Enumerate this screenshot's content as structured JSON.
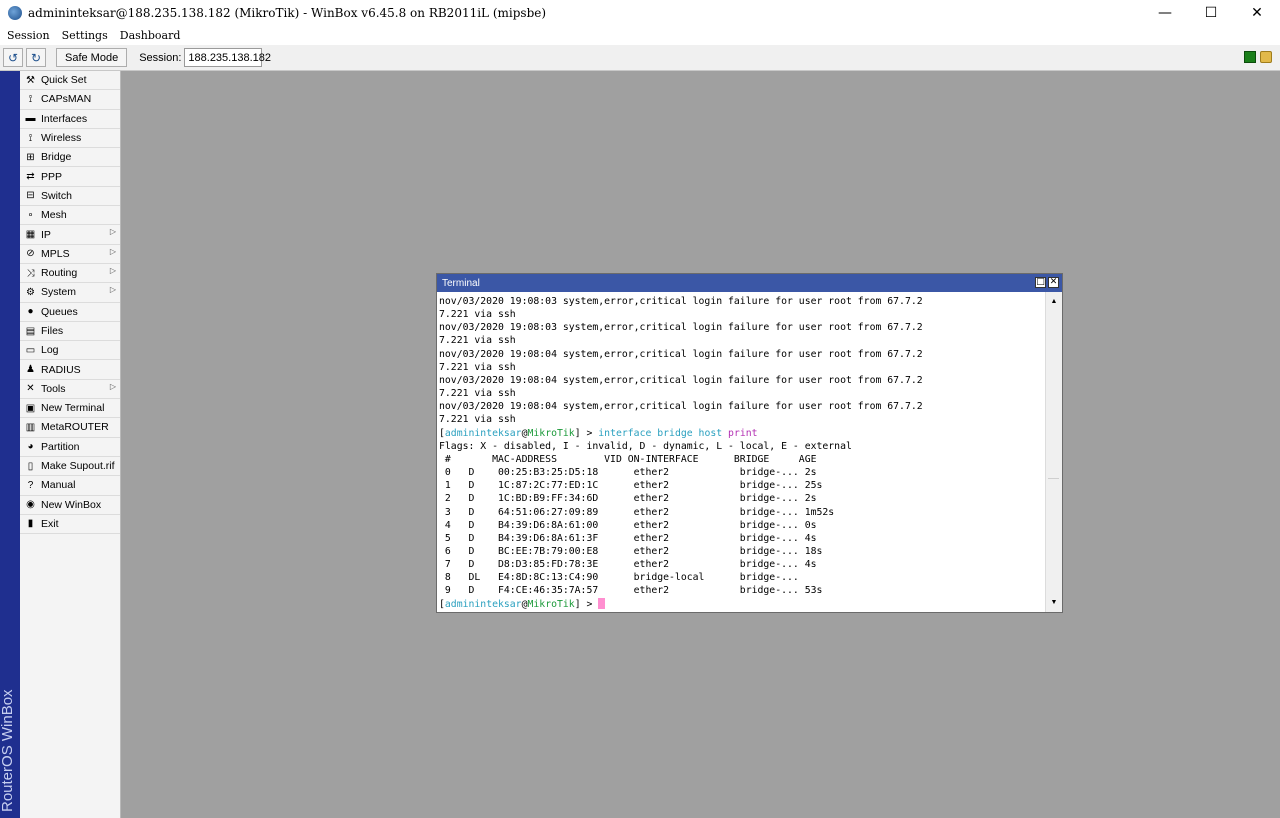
{
  "window": {
    "title": "admininteksar@188.235.138.182 (MikroTik) - WinBox v6.45.8 on RB2011iL (mipsbe)",
    "controls": {
      "minimize": "—",
      "maximize": "☐",
      "close": "✕"
    }
  },
  "menubar": {
    "items": [
      "Session",
      "Settings",
      "Dashboard"
    ]
  },
  "toolbar": {
    "undo_icon": "↺",
    "redo_icon": "↻",
    "safe_mode_label": "Safe Mode",
    "session_label": "Session:",
    "session_value": "188.235.138.182"
  },
  "brand": {
    "text": "RouterOS WinBox"
  },
  "sidebar": {
    "items": [
      {
        "label": "Quick Set",
        "icon": "quickset-icon",
        "glyph": "⚒",
        "arrow": ""
      },
      {
        "label": "CAPsMAN",
        "icon": "capsman-icon",
        "glyph": "⟟",
        "arrow": ""
      },
      {
        "label": "Interfaces",
        "icon": "interfaces-icon",
        "glyph": "▬",
        "arrow": ""
      },
      {
        "label": "Wireless",
        "icon": "wireless-icon",
        "glyph": "⟟",
        "arrow": ""
      },
      {
        "label": "Bridge",
        "icon": "bridge-icon",
        "glyph": "⊞",
        "arrow": ""
      },
      {
        "label": "PPP",
        "icon": "ppp-icon",
        "glyph": "⇄",
        "arrow": ""
      },
      {
        "label": "Switch",
        "icon": "switch-icon",
        "glyph": "⊟",
        "arrow": ""
      },
      {
        "label": "Mesh",
        "icon": "mesh-icon",
        "glyph": "∘",
        "arrow": ""
      },
      {
        "label": "IP",
        "icon": "ip-icon",
        "glyph": "▦",
        "arrow": "▷"
      },
      {
        "label": "MPLS",
        "icon": "mpls-icon",
        "glyph": "⊘",
        "arrow": "▷"
      },
      {
        "label": "Routing",
        "icon": "routing-icon",
        "glyph": "⤨",
        "arrow": "▷"
      },
      {
        "label": "System",
        "icon": "system-icon",
        "glyph": "⚙",
        "arrow": "▷"
      },
      {
        "label": "Queues",
        "icon": "queues-icon",
        "glyph": "●",
        "arrow": ""
      },
      {
        "label": "Files",
        "icon": "files-icon",
        "glyph": "▤",
        "arrow": ""
      },
      {
        "label": "Log",
        "icon": "log-icon",
        "glyph": "▭",
        "arrow": ""
      },
      {
        "label": "RADIUS",
        "icon": "radius-icon",
        "glyph": "♟",
        "arrow": ""
      },
      {
        "label": "Tools",
        "icon": "tools-icon",
        "glyph": "✕",
        "arrow": "▷"
      },
      {
        "label": "New Terminal",
        "icon": "terminal-icon",
        "glyph": "▣",
        "arrow": ""
      },
      {
        "label": "MetaROUTER",
        "icon": "metarouter-icon",
        "glyph": "▥",
        "arrow": ""
      },
      {
        "label": "Partition",
        "icon": "partition-icon",
        "glyph": "◕",
        "arrow": ""
      },
      {
        "label": "Make Supout.rif",
        "icon": "supout-icon",
        "glyph": "▯",
        "arrow": ""
      },
      {
        "label": "Manual",
        "icon": "manual-icon",
        "glyph": "?",
        "arrow": ""
      },
      {
        "label": "New WinBox",
        "icon": "winbox-icon",
        "glyph": "◉",
        "arrow": ""
      },
      {
        "label": "Exit",
        "icon": "exit-icon",
        "glyph": "▮",
        "arrow": ""
      }
    ]
  },
  "terminal": {
    "title": "Terminal",
    "restore_icon": "□",
    "close_icon": "✕",
    "scroll_up": "▲",
    "scroll_down": "▼",
    "log_lines": [
      "nov/03/2020 19:08:03 system,error,critical login failure for user root from 67.7.2",
      "7.221 via ssh",
      "nov/03/2020 19:08:03 system,error,critical login failure for user root from 67.7.2",
      "7.221 via ssh",
      "nov/03/2020 19:08:04 system,error,critical login failure for user root from 67.7.2",
      "7.221 via ssh",
      "nov/03/2020 19:08:04 system,error,critical login failure for user root from 67.7.2",
      "7.221 via ssh",
      "nov/03/2020 19:08:04 system,error,critical login failure for user root from 67.7.2",
      "7.221 via ssh"
    ],
    "prompt_open": "[",
    "prompt_user": "admininteksar",
    "prompt_at": "@",
    "prompt_host": "MikroTik",
    "prompt_close": "] > ",
    "command_part": "interface bridge host ",
    "command_verb": "print",
    "flags_line": "Flags: X - disabled, I - invalid, D - dynamic, L - local, E - external",
    "header_line": " #       MAC-ADDRESS        VID ON-INTERFACE      BRIDGE     AGE",
    "rows": [
      " 0   D    00:25:B3:25:D5:18      ether2            bridge-... 2s",
      " 1   D    1C:87:2C:77:ED:1C      ether2            bridge-... 25s",
      " 2   D    1C:BD:B9:FF:34:6D      ether2            bridge-... 2s",
      " 3   D    64:51:06:27:09:89      ether2            bridge-... 1m52s",
      " 4   D    B4:39:D6:8A:61:00      ether2            bridge-... 0s",
      " 5   D    B4:39:D6:8A:61:3F      ether2            bridge-... 4s",
      " 6   D    BC:EE:7B:79:00:E8      ether2            bridge-... 18s",
      " 7   D    D8:D3:85:FD:78:3E      ether2            bridge-... 4s",
      " 8   DL   E4:8D:8C:13:C4:90      bridge-local      bridge-...",
      " 9   D    F4:CE:46:35:7A:57      ether2            bridge-... 53s"
    ]
  }
}
